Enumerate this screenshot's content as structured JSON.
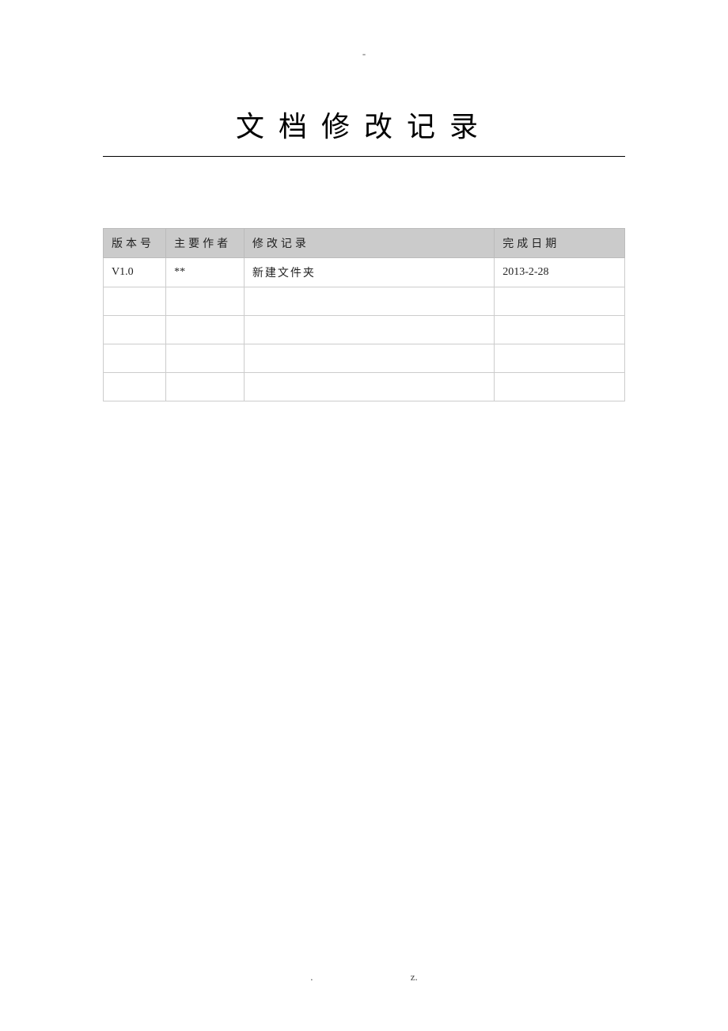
{
  "header_mark": "-",
  "title": "文档修改记录",
  "table": {
    "headers": {
      "version": "版本号",
      "author": "主要作者",
      "record": "修改记录",
      "date": "完成日期"
    },
    "rows": [
      {
        "version": "V1.0",
        "author": "**",
        "record": "新建文件夹",
        "date": "2013-2-28"
      },
      {
        "version": "",
        "author": "",
        "record": "",
        "date": ""
      },
      {
        "version": "",
        "author": "",
        "record": "",
        "date": ""
      },
      {
        "version": "",
        "author": "",
        "record": "",
        "date": ""
      },
      {
        "version": "",
        "author": "",
        "record": "",
        "date": ""
      }
    ]
  },
  "footer": {
    "left": ".",
    "right": "z."
  }
}
